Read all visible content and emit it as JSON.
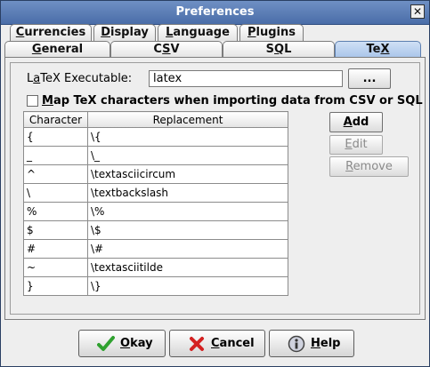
{
  "window": {
    "title": "Preferences",
    "close_glyph": "✕"
  },
  "tabs_row1": [
    {
      "pre": "",
      "ul": "C",
      "post": "urrencies"
    },
    {
      "pre": "",
      "ul": "D",
      "post": "isplay"
    },
    {
      "pre": "",
      "ul": "L",
      "post": "anguage"
    },
    {
      "pre": "",
      "ul": "P",
      "post": "lugins"
    }
  ],
  "tabs_row2": [
    {
      "pre": "",
      "ul": "G",
      "post": "eneral"
    },
    {
      "pre": "C",
      "ul": "S",
      "post": "V"
    },
    {
      "pre": "S",
      "ul": "Q",
      "post": "L"
    },
    {
      "pre": "Te",
      "ul": "X",
      "post": "",
      "active": true
    }
  ],
  "tex": {
    "exec_label_pre": "L",
    "exec_label_ul": "a",
    "exec_label_post": "TeX Executable:",
    "exec_value": "latex",
    "browse_label": "...",
    "map_checkbox_pre": "",
    "map_checkbox_ul": "M",
    "map_checkbox_post": "ap TeX characters when importing data from CSV or SQL",
    "map_checked": false,
    "columns": [
      "Character",
      "Replacement"
    ],
    "rows": [
      [
        "{",
        "\\{"
      ],
      [
        "_",
        "\\_"
      ],
      [
        "^",
        "\\textasciicircum"
      ],
      [
        "\\",
        "\\textbackslash"
      ],
      [
        "%",
        "\\%"
      ],
      [
        "$",
        "\\$"
      ],
      [
        "#",
        "\\#"
      ],
      [
        "~",
        "\\textasciitilde"
      ],
      [
        "}",
        "\\}"
      ]
    ],
    "add_label_ul": "A",
    "add_label_post": "dd",
    "edit_label_ul": "E",
    "edit_label_post": "dit",
    "remove_label_ul": "R",
    "remove_label_post": "emove"
  },
  "footer": {
    "okay_ul": "O",
    "okay_post": "kay",
    "cancel_ul": "C",
    "cancel_post": "ancel",
    "help_ul": "H",
    "help_post": "elp"
  },
  "colors": {
    "accent": "#5b7aa5",
    "ok_check": "#2fa12f",
    "cancel_x": "#d42020"
  },
  "icons": {
    "ok": "check-icon",
    "cancel": "x-icon",
    "help": "help-icon"
  }
}
